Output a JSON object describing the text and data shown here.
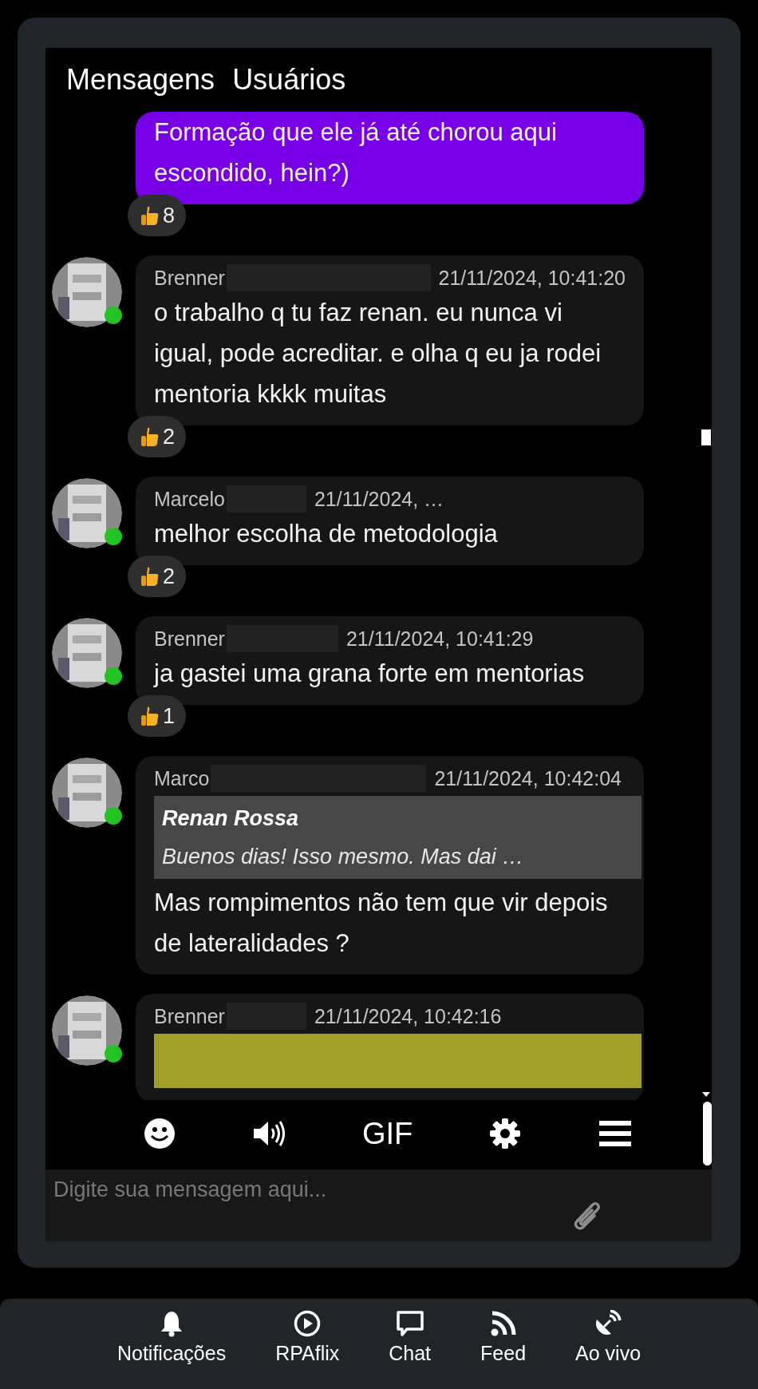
{
  "tabs": [
    {
      "label": "Mensagens"
    },
    {
      "label": "Usuários"
    }
  ],
  "messages": [
    {
      "kind": "own",
      "text": "Formação que ele já até chorou aqui escondido, hein?)",
      "reaction": "8"
    },
    {
      "kind": "user",
      "author": "Brenner",
      "time": "21/11/2024, 10:41:20",
      "online": true,
      "text": "o trabalho q tu faz renan. eu nunca vi igual, pode acreditar. e olha q eu ja rodei mentoria kkkk muitas",
      "reaction": "2"
    },
    {
      "kind": "user",
      "author": "Marcelo",
      "time": "21/11/2024, …",
      "online": true,
      "text": "melhor escolha de metodologia",
      "reaction": "2"
    },
    {
      "kind": "user",
      "author": "Brenner",
      "time": "21/11/2024, 10:41:29",
      "online": true,
      "text": "ja gastei uma grana forte em mentorias",
      "reaction": "1"
    },
    {
      "kind": "user",
      "author": "Marco",
      "time": "21/11/2024, 10:42:04",
      "online": true,
      "quote": {
        "color": "#474747",
        "author": "Renan Rossa",
        "text": "Buenos dias! Isso mesmo. Mas dai …"
      },
      "text": "Mas rompimentos não tem que vir depois de lateralidades ?"
    },
    {
      "kind": "user",
      "author": "Brenner",
      "time": "21/11/2024, 10:42:16",
      "online": true,
      "quote": {
        "color": "#a19f29"
      }
    }
  ],
  "toolbar": [
    {
      "kind": "emoji"
    },
    {
      "kind": "sound"
    },
    {
      "kind": "gif",
      "label": "GIF"
    },
    {
      "kind": "settings"
    },
    {
      "kind": "menu"
    }
  ],
  "input": {
    "placeholder": "Digite sua mensagem aqui..."
  },
  "nav": [
    {
      "kind": "bell",
      "label": "Notificações"
    },
    {
      "kind": "play",
      "label": "RPAflix"
    },
    {
      "kind": "chat",
      "label": "Chat"
    },
    {
      "kind": "feed",
      "label": "Feed"
    },
    {
      "kind": "live",
      "label": "Ao vivo"
    }
  ]
}
